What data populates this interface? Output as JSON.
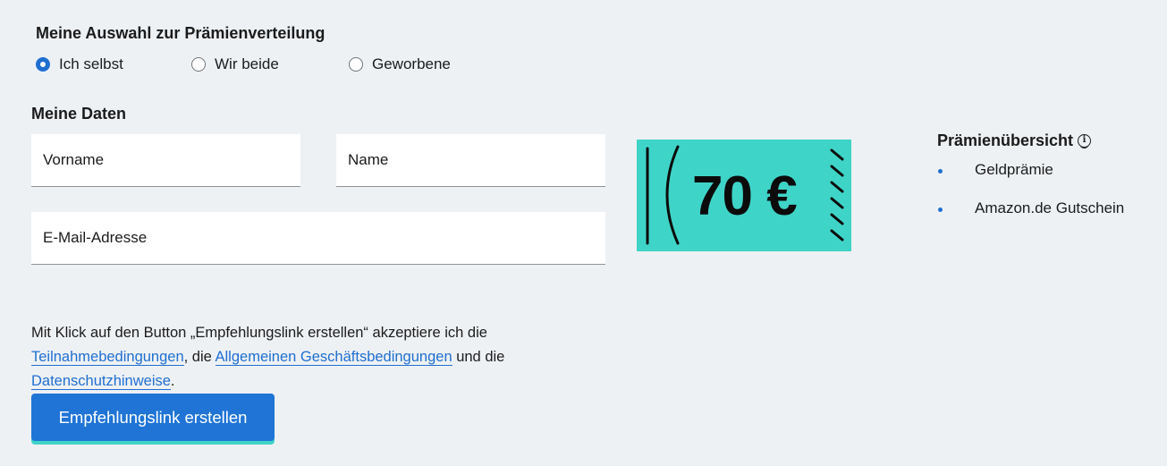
{
  "distribution": {
    "title": "Meine Auswahl zur Prämienverteilung",
    "options": [
      {
        "label": "Ich selbst",
        "checked": true
      },
      {
        "label": "Wir beide",
        "checked": false
      },
      {
        "label": "Geworbene",
        "checked": false
      }
    ]
  },
  "personal_data": {
    "title": "Meine Daten",
    "fields": {
      "firstname_placeholder": "Vorname",
      "lastname_placeholder": "Name",
      "email_placeholder": "E-Mail-Adresse"
    }
  },
  "voucher": {
    "amount": "70 €",
    "color": "#3fd4c8"
  },
  "overview": {
    "title": "Prämienübersicht",
    "info_icon": "info-icon",
    "items": [
      "Geldprämie",
      "Amazon.de Gutschein"
    ]
  },
  "consent": {
    "text_before": "Mit Klick auf den Button „Empfehlungslink erstellen“ akzeptiere ich die ",
    "link_terms": "Teilnahmebedingungen",
    "text_middle1": ", die ",
    "link_agb": "Allgemeinen Geschäftsbedingungen",
    "text_middle2": " und die ",
    "link_privacy": "Datenschutzhinweise",
    "text_after": "."
  },
  "cta": {
    "label": "Empfehlungslink erstellen",
    "color": "#1f74d6"
  }
}
